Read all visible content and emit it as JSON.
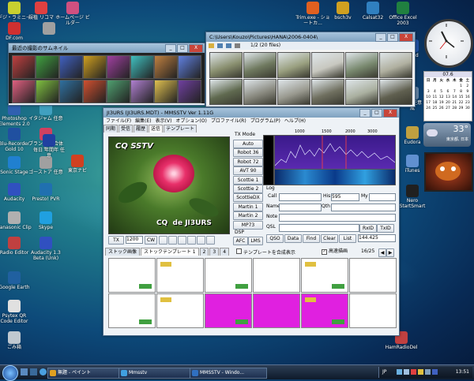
{
  "desktop": {
    "icons_left": [
      {
        "label": "デジ・ラミニーテ",
        "color": "#c8d030"
      },
      {
        "label": "DF.com",
        "color": "#d03030"
      },
      {
        "label": "",
        "color": "#4060c0"
      },
      {
        "label": "",
        "color": "#8060a0"
      },
      {
        "label": "",
        "color": "#d0a020"
      },
      {
        "label": "",
        "color": "#608040"
      },
      {
        "label": "Photoshop Elements 2.0",
        "color": "#3060b0"
      },
      {
        "label": "イタジャム 任意",
        "color": "#40a0c0"
      },
      {
        "label": "Blu-Recorder Gold 10",
        "color": "#2050a0"
      },
      {
        "label": "ブランクド 合体サ",
        "color": "#d04060"
      },
      {
        "label": "Sonic Stage",
        "color": "#2080d0"
      },
      {
        "label": "ゴーストア 任意",
        "color": "#a0a0a0"
      },
      {
        "label": "Audacity",
        "color": "#3050c0"
      },
      {
        "label": "Presto! PVR",
        "color": "#2070b0"
      },
      {
        "label": "Panasonic Clip",
        "color": "#b0b0b0"
      },
      {
        "label": "Skype",
        "color": "#20a0e0"
      },
      {
        "label": "Radio Editor",
        "color": "#c04040"
      },
      {
        "label": "Audacity 1.3 Beta (Unk)",
        "color": "#3050c0"
      },
      {
        "label": "Google Earth",
        "color": "#2060a0"
      },
      {
        "label": "Psytex QR Code Editor",
        "color": "#e0e0e0"
      },
      {
        "label": "ごみ箱",
        "color": "#c0c8d0"
      }
    ],
    "icons_mid": [
      {
        "label": "誤植 リコマ",
        "color": "#e04040"
      },
      {
        "label": "ホームページ ビルダー",
        "color": "#d05080"
      },
      {
        "label": "",
        "color": "#a0a0a0"
      },
      {
        "label": "iTunes",
        "color": "#6090d0"
      },
      {
        "label": "毎日 年間年 任意",
        "color": "#2040a0"
      },
      {
        "label": "東京ナビ",
        "color": "#d04020"
      },
      {
        "label": "",
        "color": "#40a060"
      }
    ],
    "icons_top": [
      {
        "label": "Trim.exe - ショートカ...",
        "color": "#e06020"
      },
      {
        "label": "bsch3v",
        "color": "#d0a020"
      },
      {
        "label": "Calsat32",
        "color": "#3080c0"
      },
      {
        "label": "Office Excel 2003",
        "color": "#208040"
      }
    ],
    "icons_right": [
      {
        "label": "Word",
        "color": "#2050a0"
      },
      {
        "label": "アホノ 任意 作成",
        "color": "#6080a0"
      },
      {
        "label": "Eudora",
        "color": "#c0a040"
      },
      {
        "label": "iTunes",
        "color": "#6090d0"
      },
      {
        "label": "Nero StartSmart",
        "color": "#202020"
      },
      {
        "label": "HamRadioDel",
        "color": "#c04040"
      }
    ]
  },
  "gadgets": {
    "clock": {
      "label": "clock"
    },
    "calendar": {
      "month": "07.6",
      "days": [
        "日",
        "月",
        "火",
        "水",
        "木",
        "金",
        "土"
      ],
      "rows": [
        [
          "",
          "",
          "",
          "",
          "",
          "1",
          "2"
        ],
        [
          "3",
          "4",
          "5",
          "6",
          "7",
          "8",
          "9"
        ],
        [
          "10",
          "11",
          "12",
          "13",
          "14",
          "15",
          "16"
        ],
        [
          "17",
          "18",
          "19",
          "20",
          "21",
          "22",
          "23"
        ],
        [
          "24",
          "25",
          "26",
          "27",
          "28",
          "29",
          "30"
        ]
      ]
    },
    "weather": {
      "temp": "33°",
      "city": "東京都, 日本"
    }
  },
  "thumbnail_window": {
    "title": "最近の撮影のサムネイル",
    "buttons": {
      "min": "_",
      "max": "□",
      "close": "X"
    }
  },
  "viewer_window": {
    "title": "C:\\Users\\Kouzo\\Pictures\\HANA\\2006-0404\\",
    "toolbar_text": "1/2 (20 files)",
    "buttons": {
      "min": "_",
      "max": "□",
      "close": "X"
    }
  },
  "mmsstv": {
    "title": "JI3URS (JI3URS.MDT) - MMSSTV Ver 1.11G",
    "buttons": {
      "min": "_",
      "max": "□",
      "close": "X"
    },
    "menu": [
      "ファイル(F)",
      "編集(E)",
      "表示(V)",
      "オプション(O)",
      "プロファイル(R)",
      "プログラム(P)",
      "ヘルプ(H)"
    ],
    "tabs": [
      "同期",
      "受信",
      "履歴",
      "送信",
      "テンプレート"
    ],
    "active_tab": "送信",
    "image_text_top": "CQ SSTV",
    "image_text_bottom": "CQ  de JI3URS",
    "tx_mode_label": "TX Mode",
    "modes": [
      "Auto",
      "Robot 36",
      "Robot 72",
      "AVT 90",
      "Scottie 1",
      "Scottie 2",
      "ScottieDX",
      "Martin 1",
      "Martin 2",
      "MP73"
    ],
    "freq_ticks": [
      "1000",
      "1500",
      "2000",
      "3000"
    ],
    "log_label": "Log",
    "fields": {
      "call": "Call",
      "his": "His",
      "his_value": "595",
      "my": "My",
      "name": "Name",
      "qth": "Qth",
      "note": "Note",
      "qsl": "QSL"
    },
    "rx_buttons": [
      "RxID",
      "TxID"
    ],
    "log_buttons": [
      "QSO",
      "Data",
      "Find",
      "Clear",
      "List"
    ],
    "freq_value": "144.425",
    "tx_controls": {
      "tx": "TX",
      "value": "1200",
      "cw": "CW"
    },
    "dsp_label": "DSP",
    "afc": "AFC",
    "lms": "LMS",
    "stock_tabs": [
      "ストック画像",
      "ストックテンプレート 1",
      "2",
      "3",
      "4"
    ],
    "template_check": "テンプレートを合成表示",
    "hq_check": "高速描画",
    "page_info": "16/25"
  },
  "taskbar": {
    "items": [
      {
        "label": "無題 - ペイント",
        "color": "#e0a020"
      },
      {
        "label": "Mmsstv",
        "color": "#40a0e0"
      },
      {
        "label": "MMSSTV - Windo...",
        "color": "#3070c0"
      }
    ],
    "lang": "JP",
    "time": "13:51"
  }
}
